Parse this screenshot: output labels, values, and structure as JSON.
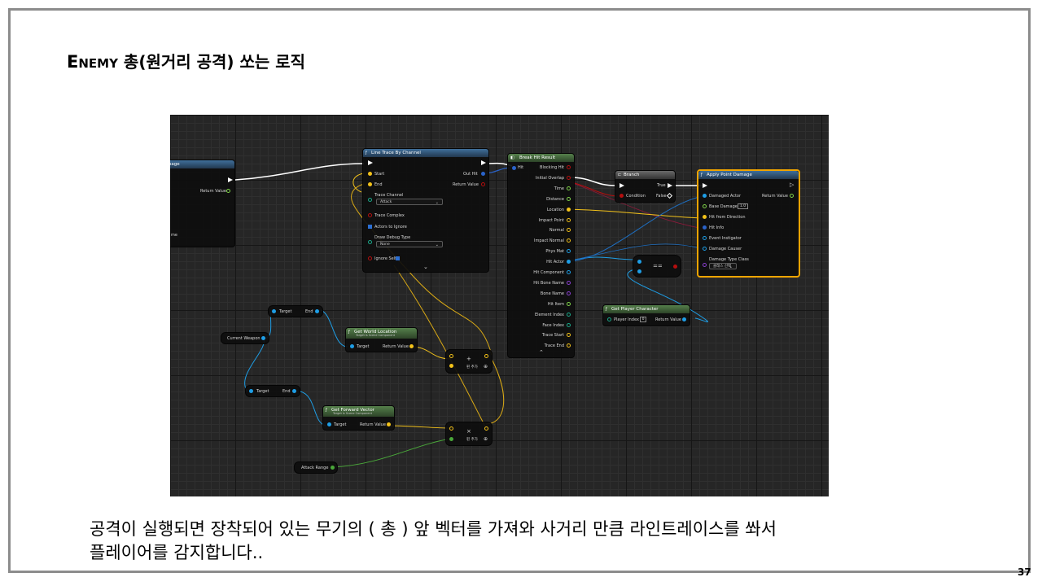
{
  "slide": {
    "title_first": "E",
    "title_rest": "NEMY",
    "title_korean": " 총(원거리 공격) 쏘는 로직",
    "caption_line1": "공격이 실행되면 장착되어 있는 무기의 ( 총 ) 앞 벡터를 가져와 사거리 만큼 라인트레이스를 쏴서",
    "caption_line2": "플레이어를 감지합니다..",
    "page_number": "37"
  },
  "blueprint": {
    "left_node": {
      "title": "mage",
      "return_value": "Return Value",
      "partial_label": "me"
    },
    "line_trace": {
      "title": "Line Trace By Channel",
      "start": "Start",
      "end": "End",
      "out_hit": "Out Hit",
      "return_value": "Return Value",
      "trace_channel_label": "Trace Channel",
      "trace_channel_value": "Attack",
      "trace_complex": "Trace Complex",
      "actors_to_ignore": "Actors to Ignore",
      "draw_debug_label": "Draw Debug Type",
      "draw_debug_value": "None",
      "ignore_self": "Ignore Self"
    },
    "break_hit": {
      "title": "Break Hit Result",
      "hit": "Hit",
      "outputs": [
        "Blocking Hit",
        "Initial Overlap",
        "Time",
        "Distance",
        "Location",
        "Impact Point",
        "Normal",
        "Impact Normal",
        "Phys Mat",
        "Hit Actor",
        "Hit Component",
        "Hit Bone Name",
        "Bone Name",
        "Hit Item",
        "Element Index",
        "Face Index",
        "Trace Start",
        "Trace End"
      ]
    },
    "branch": {
      "title": "Branch",
      "condition": "Condition",
      "true_label": "True",
      "false_label": "False"
    },
    "apply_damage": {
      "title": "Apply Point Damage",
      "damaged_actor": "Damaged Actor",
      "return_value": "Return Value",
      "base_damage": "Base Damage",
      "base_damage_value": "1.0",
      "hit_from_direction": "Hit from Direction",
      "hit_info": "Hit Info",
      "event_instigator": "Event Instigator",
      "damage_causer": "Damage Causer",
      "damage_type_class": "Damage Type Class",
      "damage_type_value": "클래스 선택"
    },
    "equals": {
      "symbol": "=="
    },
    "get_player": {
      "title": "Get Player Character",
      "player_index": "Player Index",
      "player_index_value": "0",
      "return_value": "Return Value"
    },
    "get_component_top": {
      "target": "Target",
      "end": "End"
    },
    "get_component_bottom": {
      "target": "Target",
      "end": "End"
    },
    "current_weapon": {
      "label": "Current Weapon"
    },
    "world_location": {
      "title": "Get World Location",
      "subtitle": "Target is Scene Component",
      "target": "Target",
      "return_value": "Return Value"
    },
    "forward_vector": {
      "title": "Get Forward Vector",
      "subtitle": "Target is Scene Component",
      "target": "Target",
      "return_value": "Return Value"
    },
    "add_node": {
      "symbol": "+",
      "add_pin": "핀 추가"
    },
    "mul_node": {
      "symbol": "×",
      "add_pin": "핀 추가"
    },
    "attack_range": {
      "label": "Attack Range"
    }
  },
  "colors": {
    "exec": "#ffffff",
    "vector": "#f3c21a",
    "object": "#1e9ee6",
    "float": "#7fd34a",
    "bool": "#b50e0e",
    "struct": "#2a63c9",
    "selection": "#f0a400"
  }
}
